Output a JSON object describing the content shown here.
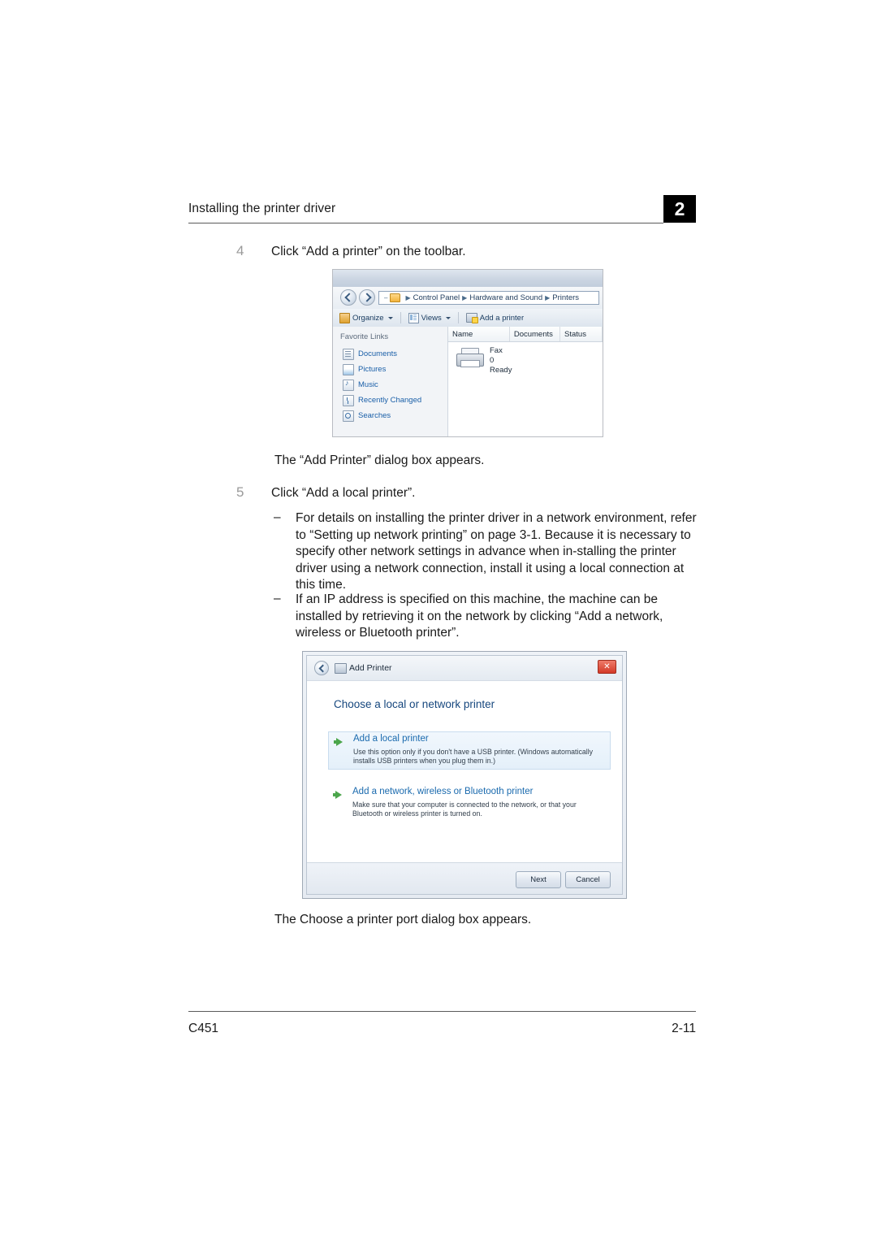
{
  "header": {
    "title": "Installing the printer driver",
    "chapter": "2"
  },
  "footer": {
    "model": "C451",
    "page": "2-11"
  },
  "steps": {
    "step4_num": "4",
    "step4_text": "Click “Add a printer” on the toolbar.",
    "after_step4": "The “Add Printer” dialog box appears.",
    "step5_num": "5",
    "step5_text": "Click “Add a local printer”.",
    "bullet1_dash": "–",
    "bullet1_text": "For details on installing the printer driver in a network environment, refer to “Setting up network printing” on page 3-1. Because it is necessary to specify other network settings in advance when in-stalling the printer driver using a network connection, install it using a local connection at this time.",
    "bullet2_dash": "–",
    "bullet2_text": "If an IP address is specified on this machine, the machine can be installed by retrieving it on the network by clicking “Add a network, wireless or Bluetooth printer”.",
    "after_step5": "The Choose a printer port dialog box appears."
  },
  "screenshot_printers": {
    "address_crumbs": [
      "Control Panel",
      "Hardware and Sound",
      "Printers"
    ],
    "toolbar": {
      "organize": "Organize",
      "views": "Views",
      "add_printer": "Add a printer"
    },
    "columns": [
      "Name",
      "Documents",
      "Status"
    ],
    "favorites_title": "Favorite Links",
    "favorites": [
      {
        "label": "Documents",
        "icon": "documents-icon"
      },
      {
        "label": "Pictures",
        "icon": "pictures-icon"
      },
      {
        "label": "Music",
        "icon": "music-icon"
      },
      {
        "label": "Recently Changed",
        "icon": "recent-icon"
      },
      {
        "label": "Searches",
        "icon": "search-icon"
      }
    ],
    "item": {
      "name": "Fax",
      "documents": "0",
      "status": "Ready"
    }
  },
  "screenshot_add_printer": {
    "title": "Add Printer",
    "close_glyph": "✕",
    "heading": "Choose a local or network printer",
    "options": [
      {
        "title": "Add a local printer",
        "description": "Use this option only if you don't have a USB printer. (Windows automatically installs USB printers when you plug them in.)"
      },
      {
        "title": "Add a network, wireless or Bluetooth printer",
        "description": "Make sure that your computer is connected to the network, or that your Bluetooth or wireless printer is turned on."
      }
    ],
    "buttons": {
      "next": "Next",
      "cancel": "Cancel"
    }
  }
}
